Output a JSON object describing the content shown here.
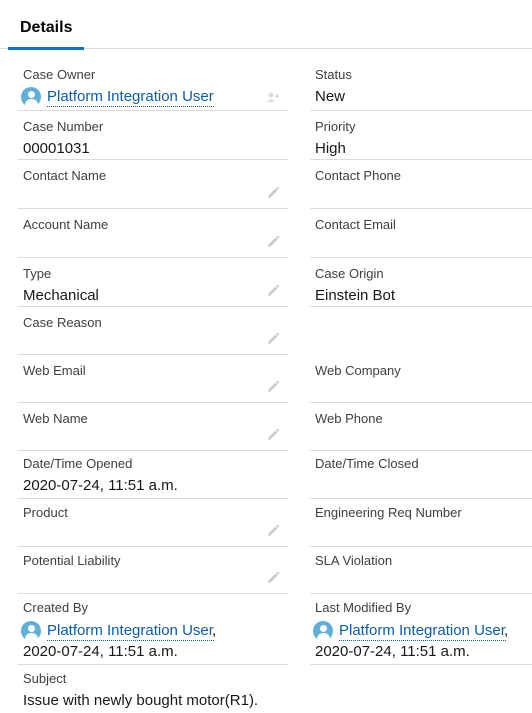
{
  "tab": {
    "label": "Details"
  },
  "fields": {
    "case_owner": {
      "label": "Case Owner",
      "user": "Platform Integration User"
    },
    "status": {
      "label": "Status",
      "value": "New"
    },
    "case_number": {
      "label": "Case Number",
      "value": "00001031"
    },
    "priority": {
      "label": "Priority",
      "value": "High"
    },
    "contact_name": {
      "label": "Contact Name",
      "value": ""
    },
    "contact_phone": {
      "label": "Contact Phone",
      "value": ""
    },
    "account_name": {
      "label": "Account Name",
      "value": ""
    },
    "contact_email": {
      "label": "Contact Email",
      "value": ""
    },
    "type": {
      "label": "Type",
      "value": "Mechanical"
    },
    "case_origin": {
      "label": "Case Origin",
      "value": "Einstein Bot"
    },
    "case_reason": {
      "label": "Case Reason",
      "value": ""
    },
    "web_email": {
      "label": "Web Email",
      "value": ""
    },
    "web_company": {
      "label": "Web Company",
      "value": ""
    },
    "web_name": {
      "label": "Web Name",
      "value": ""
    },
    "web_phone": {
      "label": "Web Phone",
      "value": ""
    },
    "date_opened": {
      "label": "Date/Time Opened",
      "value": "2020-07-24, 11:51 a.m."
    },
    "date_closed": {
      "label": "Date/Time Closed",
      "value": ""
    },
    "product": {
      "label": "Product",
      "value": ""
    },
    "engineering_req": {
      "label": "Engineering Req Number",
      "value": ""
    },
    "potential_liability": {
      "label": "Potential Liability",
      "value": ""
    },
    "sla_violation": {
      "label": "SLA Violation",
      "value": ""
    },
    "created_by": {
      "label": "Created By",
      "user": "Platform Integration User",
      "separator": ",",
      "date": "2020-07-24, 11:51 a.m."
    },
    "last_modified_by": {
      "label": "Last Modified By",
      "user": "Platform Integration User",
      "separator": ",",
      "date": "2020-07-24, 11:51 a.m."
    },
    "subject": {
      "label": "Subject",
      "value": "Issue with newly bought motor(R1)."
    }
  },
  "icons": {
    "avatar": "user-avatar-icon",
    "edit": "pencil-edit-icon",
    "owner_change": "change-owner-icon"
  },
  "colors": {
    "link": "#0b5cab",
    "tab_accent": "#0176d3",
    "avatar": "#5fb0d8",
    "divider": "#dddbda",
    "edit_icon": "#c9c9c9"
  }
}
